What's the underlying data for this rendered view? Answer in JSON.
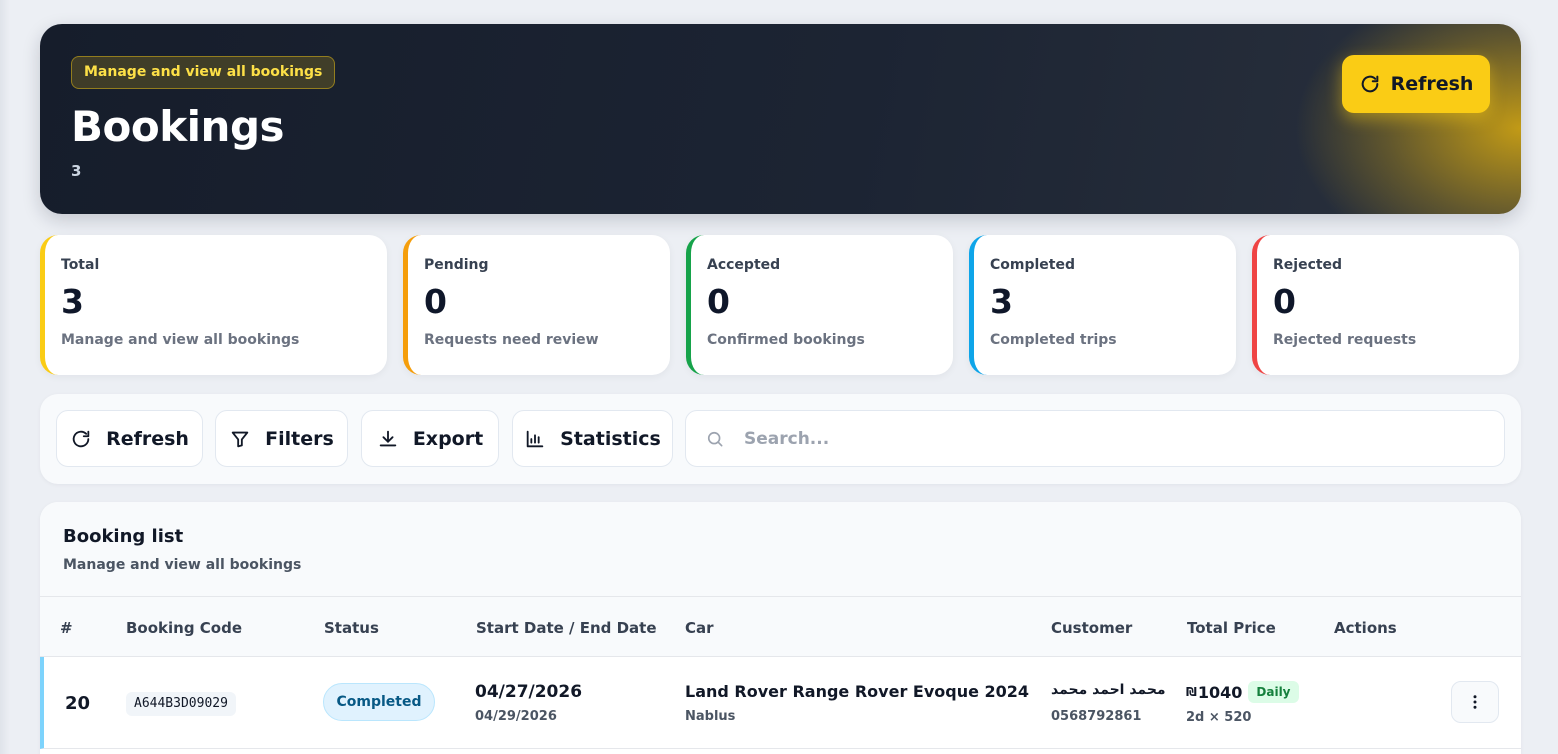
{
  "hero": {
    "badge": "Manage and view all bookings",
    "title": "Bookings",
    "count": "3",
    "refresh_label": "Refresh",
    "accent": "#facc15"
  },
  "stats": [
    {
      "label": "Total",
      "value": "3",
      "desc": "Manage and view all bookings",
      "color": "#facc15"
    },
    {
      "label": "Pending",
      "value": "0",
      "desc": "Requests need review",
      "color": "#f59e0b"
    },
    {
      "label": "Accepted",
      "value": "0",
      "desc": "Confirmed bookings",
      "color": "#16a34a"
    },
    {
      "label": "Completed",
      "value": "3",
      "desc": "Completed trips",
      "color": "#0ea5e9"
    },
    {
      "label": "Rejected",
      "value": "0",
      "desc": "Rejected requests",
      "color": "#ef4444"
    }
  ],
  "toolbar": {
    "refresh_label": "Refresh",
    "filters_label": "Filters",
    "export_label": "Export",
    "statistics_label": "Statistics",
    "search_placeholder": "Search..."
  },
  "list": {
    "title": "Booking list",
    "subtitle": "Manage and view all bookings",
    "columns": [
      "#",
      "Booking Code",
      "Status",
      "Start Date / End Date",
      "Car",
      "Customer",
      "Total Price",
      "Actions"
    ],
    "rows": [
      {
        "num": "20",
        "code": "A644B3D09029",
        "status": "Completed",
        "start": "04/27/2026",
        "end": "04/29/2026",
        "car": "Land Rover Range Rover Evoque 2024",
        "city": "Nablus",
        "customer": "محمد احمد محمد",
        "phone": "0568792861",
        "currency": "₪",
        "price": "1040",
        "rate": "Daily",
        "breakdown": "2d × 520"
      }
    ]
  },
  "icons": {
    "refresh": "refresh-icon",
    "filter": "filter-icon",
    "export": "download-icon",
    "statistics": "bar-chart-icon",
    "search": "search-icon",
    "actions": "more-vertical-icon"
  }
}
